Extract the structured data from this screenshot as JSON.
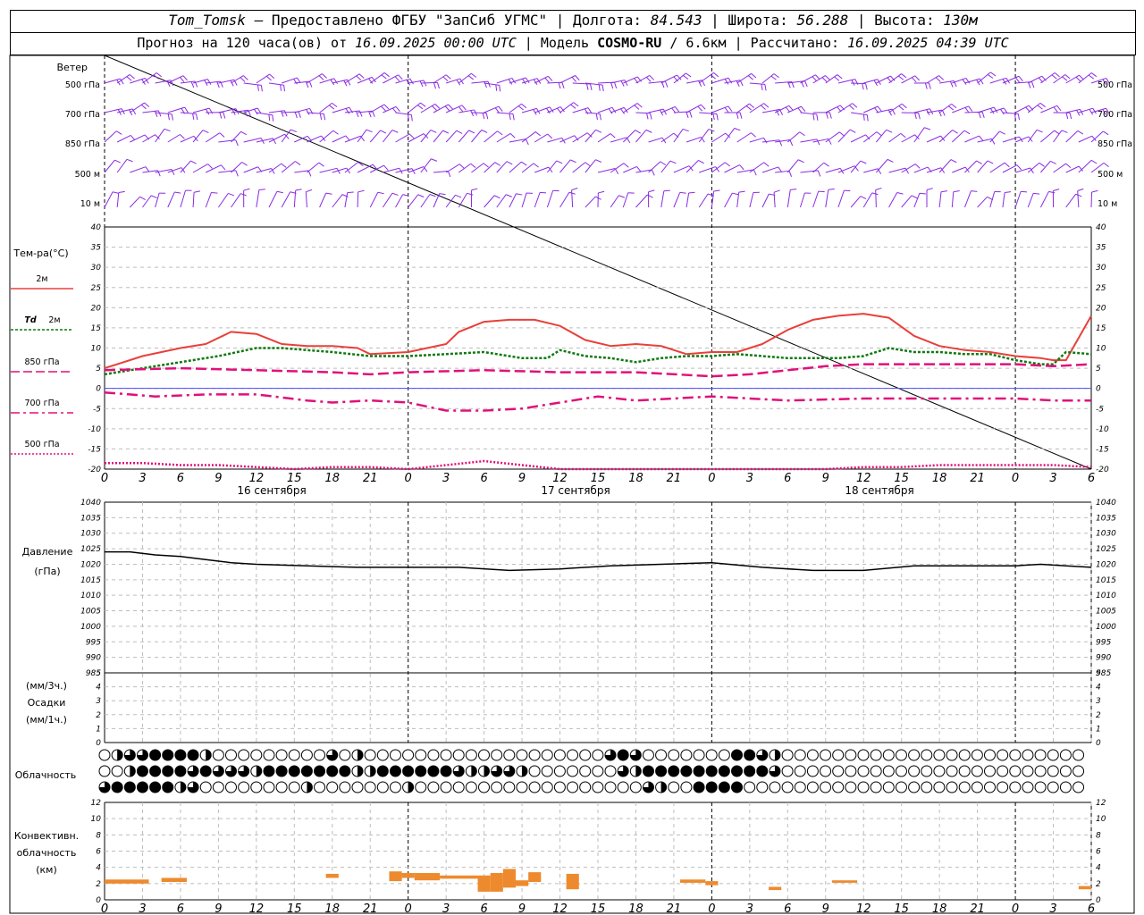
{
  "header": {
    "station": "Tom_Tomsk",
    "provider": " – Предоставлено ФГБУ \"ЗапСиб УГМС\" | Долгота: ",
    "longitude": "84.543",
    "lat_label": " | Широта: ",
    "latitude": "56.288",
    "alt_label": " | Высота: ",
    "altitude": "130м",
    "forecast_label": "Прогноз на 120 часа(ов) от ",
    "forecast_start": "16.09.2025 00:00 UTC",
    "model_label": " | Модель ",
    "model": "COSMO-RU",
    "resolution": " / 6.6км",
    "calc_label": " | Рассчитано: ",
    "calc_time": "16.09.2025 04:39 UTC"
  },
  "labels": {
    "wind": "Ветер",
    "wind_levels": [
      "500 гПа",
      "700 гПа",
      "850 гПа",
      "500 м",
      "10 м"
    ],
    "temp": "Тем-ра(°C)",
    "t2m": "2м",
    "td_prefix": "Td",
    "td2m": "2м",
    "t850": "850 гПа",
    "t700": "700 гПа",
    "t500": "500 гПа",
    "pressure": "Давление",
    "pressure_unit": "(гПа)",
    "precip_unit3": "(мм/3ч.)",
    "precip": "Осадки",
    "precip_unit1": "(мм/1ч.)",
    "cloud": "Облачность",
    "conv1": "Конвективн.",
    "conv2": "облачность",
    "conv3": "(км)",
    "days": [
      "16 сентября",
      "17 сентября",
      "18 сентября"
    ]
  },
  "colors": {
    "wind": "#8a2be2",
    "t2m": "#e8403a",
    "td2m": "#0f7a0f",
    "t850": "#e0107a",
    "t700": "#e0107a",
    "t500": "#e0107a",
    "pressure": "#000000",
    "conv": "#ee8a2e",
    "zero_line": "#4a4aff"
  },
  "chart_data": [
    {
      "type": "line",
      "title": "Тем-ра(°C)",
      "x_unit": "hours since 16.09.2025 00:00 UTC",
      "ylim": [
        -20,
        40
      ],
      "x_ticks": [
        0,
        3,
        6,
        9,
        12,
        15,
        18,
        21,
        0,
        3,
        6,
        9,
        12,
        15,
        18,
        21,
        0,
        3,
        6,
        9,
        12,
        15,
        18,
        21,
        0,
        3,
        6
      ],
      "series": [
        {
          "name": "2м",
          "x": [
            0,
            3,
            6,
            8,
            10,
            12,
            14,
            16,
            18,
            20,
            21,
            24,
            27,
            28,
            30,
            32,
            34,
            36,
            38,
            40,
            42,
            44,
            46,
            48,
            50,
            52,
            54,
            56,
            58,
            60,
            62,
            64,
            66,
            68,
            70,
            72,
            74,
            75,
            76,
            78
          ],
          "values": [
            5,
            8,
            10,
            11,
            14,
            13.5,
            11,
            10.5,
            10.5,
            10,
            8.5,
            9,
            11,
            14,
            16.5,
            17,
            17,
            15.5,
            12,
            10.5,
            11,
            10.5,
            8.5,
            9,
            9,
            11,
            14.5,
            17,
            18,
            18.5,
            17.5,
            13,
            10.5,
            9.5,
            9,
            8,
            7.5,
            7,
            7,
            18
          ]
        },
        {
          "name": "Td 2м",
          "x": [
            0,
            3,
            6,
            9,
            12,
            14,
            16,
            18,
            21,
            24,
            27,
            30,
            33,
            35,
            36,
            38,
            40,
            42,
            44,
            46,
            48,
            50,
            52,
            54,
            56,
            58,
            60,
            62,
            64,
            66,
            68,
            70,
            72,
            74,
            75,
            76,
            78
          ],
          "values": [
            3.5,
            5,
            6.5,
            8,
            10,
            10,
            9.5,
            9,
            8,
            8,
            8.5,
            9,
            7.5,
            7.5,
            9.5,
            8,
            7.5,
            6.5,
            7.5,
            8,
            8,
            8.5,
            8,
            7.5,
            7.5,
            7.5,
            8,
            10,
            9,
            9,
            8.5,
            8.5,
            7,
            6,
            6,
            9,
            8.5
          ]
        },
        {
          "name": "850 гПа",
          "x": [
            0,
            6,
            12,
            18,
            21,
            24,
            30,
            36,
            42,
            48,
            51,
            54,
            57,
            60,
            66,
            72,
            75,
            78
          ],
          "values": [
            4.5,
            5,
            4.5,
            4,
            3.5,
            4,
            4.5,
            4,
            4,
            3,
            3.5,
            4.5,
            5.5,
            6,
            6,
            6,
            5.5,
            6
          ]
        },
        {
          "name": "700 гПа",
          "x": [
            0,
            4,
            8,
            12,
            16,
            18,
            21,
            24,
            27,
            30,
            33,
            36,
            39,
            42,
            48,
            54,
            60,
            66,
            72,
            75,
            78
          ],
          "values": [
            -1,
            -2,
            -1.5,
            -1.5,
            -3,
            -3.5,
            -3,
            -3.5,
            -5.5,
            -5.5,
            -5,
            -3.5,
            -2,
            -3,
            -2,
            -3,
            -2.5,
            -2.5,
            -2.5,
            -3,
            -3
          ]
        },
        {
          "name": "500 гПа",
          "x": [
            0,
            3,
            6,
            9,
            12,
            15,
            18,
            21,
            24,
            27,
            30,
            33,
            36,
            39,
            42,
            48,
            54,
            57,
            60,
            63,
            66,
            69,
            72,
            75,
            78
          ],
          "values": [
            -18.5,
            -18.5,
            -19,
            -19,
            -19.5,
            -20,
            -19.5,
            -19.5,
            -20,
            -19,
            -18,
            -19,
            -20,
            -21,
            -22,
            -22,
            -21,
            -20,
            -19.5,
            -19.5,
            -19,
            -19,
            -19,
            -19,
            -19.5
          ]
        }
      ]
    },
    {
      "type": "line",
      "title": "Давление (гПа)",
      "ylim": [
        985,
        1040
      ],
      "series": [
        {
          "name": "Давление",
          "x": [
            0,
            2,
            4,
            6,
            8,
            10,
            12,
            16,
            20,
            24,
            28,
            32,
            36,
            40,
            44,
            48,
            52,
            56,
            60,
            64,
            68,
            72,
            74,
            76,
            78
          ],
          "values": [
            1024,
            1024,
            1023,
            1022.5,
            1021.5,
            1020.5,
            1020,
            1019.5,
            1019,
            1019,
            1019,
            1018,
            1018.5,
            1019.5,
            1020,
            1020.5,
            1019,
            1018,
            1018,
            1019.5,
            1019.5,
            1019.5,
            1020,
            1019.5,
            1019
          ]
        }
      ]
    },
    {
      "type": "bar",
      "title": "Осадки",
      "ylim": [
        0,
        5
      ],
      "values": []
    },
    {
      "type": "bar",
      "title": "Конвективн. облачность (км)",
      "ylim": [
        0,
        12
      ],
      "bars": [
        {
          "x0": 0,
          "x1": 3.5,
          "bottom": 2,
          "top": 2.5
        },
        {
          "x0": 4.5,
          "x1": 6.5,
          "bottom": 2.2,
          "top": 2.7
        },
        {
          "x0": 17.5,
          "x1": 18.5,
          "bottom": 2.7,
          "top": 3.2
        },
        {
          "x0": 22.5,
          "x1": 23.5,
          "bottom": 2.3,
          "top": 3.5
        },
        {
          "x0": 23.5,
          "x1": 24.5,
          "bottom": 2.7,
          "top": 3.3
        },
        {
          "x0": 24.5,
          "x1": 26.5,
          "bottom": 2.4,
          "top": 3.3
        },
        {
          "x0": 26.5,
          "x1": 29.5,
          "bottom": 2.6,
          "top": 3.0
        },
        {
          "x0": 29.5,
          "x1": 30.5,
          "bottom": 1.0,
          "top": 3.0
        },
        {
          "x0": 30.5,
          "x1": 31.5,
          "bottom": 1.0,
          "top": 3.3
        },
        {
          "x0": 31.5,
          "x1": 32.5,
          "bottom": 1.5,
          "top": 3.8
        },
        {
          "x0": 32.5,
          "x1": 33.5,
          "bottom": 1.7,
          "top": 2.4
        },
        {
          "x0": 33.5,
          "x1": 34.5,
          "bottom": 2.2,
          "top": 3.4
        },
        {
          "x0": 36.5,
          "x1": 37.5,
          "bottom": 1.3,
          "top": 3.2
        },
        {
          "x0": 45.5,
          "x1": 47.5,
          "bottom": 2.1,
          "top": 2.5
        },
        {
          "x0": 47.5,
          "x1": 48.5,
          "bottom": 1.8,
          "top": 2.3
        },
        {
          "x0": 52.5,
          "x1": 53.5,
          "bottom": 1.2,
          "top": 1.6
        },
        {
          "x0": 57.5,
          "x1": 59.5,
          "bottom": 2.1,
          "top": 2.4
        },
        {
          "x0": 77,
          "x1": 78,
          "bottom": 1.3,
          "top": 1.7
        }
      ]
    }
  ],
  "cloud_rows": [
    [
      0,
      2,
      3,
      3,
      4,
      4,
      4,
      4,
      2,
      0,
      0,
      0,
      0,
      0,
      0,
      0,
      0,
      0,
      3,
      0,
      2,
      0,
      0,
      0,
      0,
      0,
      0,
      0,
      0,
      0,
      0,
      0,
      0,
      0,
      0,
      0,
      0,
      0,
      0,
      0,
      3,
      4,
      3,
      0,
      0,
      0,
      0,
      0,
      0,
      0,
      4,
      4,
      3,
      2,
      0,
      0,
      0,
      0,
      0,
      0,
      0,
      0,
      0,
      0,
      0,
      0,
      0,
      0,
      0,
      0,
      0,
      0,
      0,
      0,
      0,
      0,
      0,
      0
    ],
    [
      0,
      0,
      2,
      4,
      4,
      4,
      4,
      3,
      4,
      3,
      3,
      3,
      2,
      4,
      4,
      4,
      4,
      4,
      4,
      4,
      2,
      2,
      4,
      4,
      4,
      4,
      4,
      4,
      3,
      2,
      2,
      3,
      3,
      2,
      0,
      0,
      0,
      0,
      0,
      0,
      0,
      3,
      2,
      4,
      4,
      4,
      4,
      4,
      4,
      4,
      4,
      4,
      4,
      3,
      0,
      0,
      0,
      0,
      0,
      0,
      0,
      0,
      0,
      0,
      0,
      0,
      0,
      0,
      0,
      0,
      0,
      0,
      0,
      0,
      0,
      0,
      0,
      0
    ],
    [
      3,
      4,
      4,
      4,
      4,
      4,
      2,
      3,
      0,
      0,
      0,
      0,
      0,
      0,
      0,
      0,
      2,
      0,
      0,
      0,
      0,
      0,
      0,
      0,
      2,
      0,
      0,
      0,
      0,
      0,
      0,
      0,
      0,
      0,
      0,
      0,
      0,
      0,
      0,
      0,
      0,
      0,
      0,
      3,
      2,
      0,
      0,
      4,
      4,
      4,
      4,
      0,
      0,
      0,
      0,
      0,
      0,
      0,
      0,
      0,
      0,
      0,
      0,
      0,
      0,
      0,
      0,
      0,
      0,
      0,
      0,
      0,
      0,
      0,
      0,
      0,
      0,
      0
    ]
  ]
}
